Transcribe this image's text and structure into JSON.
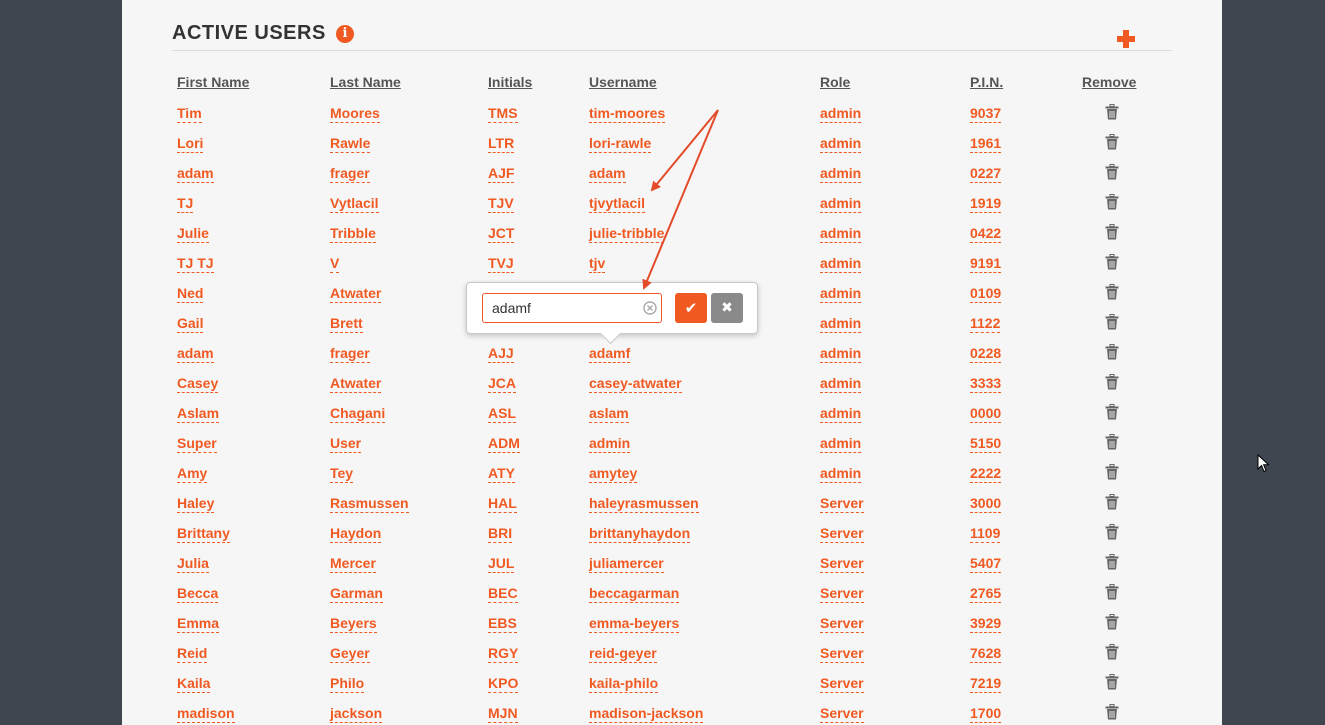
{
  "header": {
    "title": "ACTIVE USERS",
    "info_glyph": "i"
  },
  "icons": {
    "info": "info-icon",
    "add": "plus-icon",
    "remove": "trash-icon",
    "confirm": "check-icon",
    "cancel": "close-icon",
    "clear": "clear-circle-icon"
  },
  "colors": {
    "accent": "#f05a22",
    "page_bg": "#3f4650",
    "panel_bg": "#f6f6f6",
    "cancel_bg": "#8a8a8a"
  },
  "table": {
    "columns": [
      "First Name",
      "Last Name",
      "Initials",
      "Username",
      "Role",
      "P.I.N.",
      "Remove"
    ],
    "rows": [
      {
        "first": "Tim",
        "last": "Moores",
        "initials": "TMS",
        "username": "tim-moores",
        "role": "admin",
        "pin": "9037"
      },
      {
        "first": "Lori",
        "last": "Rawle",
        "initials": "LTR",
        "username": "lori-rawle",
        "role": "admin",
        "pin": "1961"
      },
      {
        "first": "adam",
        "last": "frager",
        "initials": "AJF",
        "username": "adam",
        "role": "admin",
        "pin": "0227"
      },
      {
        "first": "TJ",
        "last": "Vytlacil",
        "initials": "TJV",
        "username": "tjvytlacil",
        "role": "admin",
        "pin": "1919"
      },
      {
        "first": "Julie",
        "last": "Tribble",
        "initials": "JCT",
        "username": "julie-tribble",
        "role": "admin",
        "pin": "0422"
      },
      {
        "first": "TJ TJ",
        "last": "V",
        "initials": "TVJ",
        "username": "tjv",
        "role": "admin",
        "pin": "9191"
      },
      {
        "first": "Ned",
        "last": "Atwater",
        "initials": "",
        "username": "",
        "role": "admin",
        "pin": "0109"
      },
      {
        "first": "Gail",
        "last": "Brett",
        "initials": "",
        "username": "",
        "role": "admin",
        "pin": "1122"
      },
      {
        "first": "adam",
        "last": "frager",
        "initials": "AJJ",
        "username": "adamf",
        "role": "admin",
        "pin": "0228"
      },
      {
        "first": "Casey",
        "last": "Atwater",
        "initials": "JCA",
        "username": "casey-atwater",
        "role": "admin",
        "pin": "3333"
      },
      {
        "first": "Aslam",
        "last": "Chagani",
        "initials": "ASL",
        "username": "aslam",
        "role": "admin",
        "pin": "0000"
      },
      {
        "first": "Super",
        "last": "User",
        "initials": "ADM",
        "username": "admin",
        "role": "admin",
        "pin": "5150"
      },
      {
        "first": "Amy",
        "last": "Tey",
        "initials": "ATY",
        "username": "amytey",
        "role": "admin",
        "pin": "2222"
      },
      {
        "first": "Haley",
        "last": "Rasmussen",
        "initials": "HAL",
        "username": "haleyrasmussen",
        "role": "Server",
        "pin": "3000"
      },
      {
        "first": "Brittany",
        "last": "Haydon",
        "initials": "BRI",
        "username": "brittanyhaydon",
        "role": "Server",
        "pin": "1109"
      },
      {
        "first": "Julia",
        "last": "Mercer",
        "initials": "JUL",
        "username": "juliamercer",
        "role": "Server",
        "pin": "5407"
      },
      {
        "first": "Becca",
        "last": "Garman",
        "initials": "BEC",
        "username": "beccagarman",
        "role": "Server",
        "pin": "2765"
      },
      {
        "first": "Emma",
        "last": "Beyers",
        "initials": "EBS",
        "username": "emma-beyers",
        "role": "Server",
        "pin": "3929"
      },
      {
        "first": "Reid",
        "last": "Geyer",
        "initials": "RGY",
        "username": "reid-geyer",
        "role": "Server",
        "pin": "7628"
      },
      {
        "first": "Kaila",
        "last": "Philo",
        "initials": "KPO",
        "username": "kaila-philo",
        "role": "Server",
        "pin": "7219"
      },
      {
        "first": "madison",
        "last": "jackson",
        "initials": "MJN",
        "username": "madison-jackson",
        "role": "Server",
        "pin": "1700"
      }
    ]
  },
  "editor": {
    "value": "adamf",
    "confirm_glyph": "✔",
    "cancel_glyph": "✖"
  }
}
